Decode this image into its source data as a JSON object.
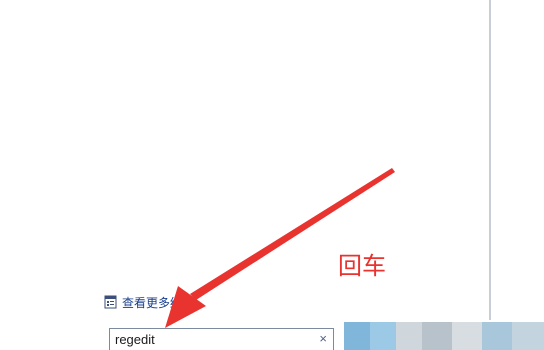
{
  "start_menu": {
    "see_more_label": "查看更多结果",
    "search": {
      "value": "regedit",
      "clear_glyph": "×"
    }
  },
  "annotation": {
    "text": "回车",
    "color": "#e8332f"
  },
  "icons": {
    "see_more": "search-results-icon",
    "clear": "close-icon"
  },
  "colors": {
    "link_text": "#1a3f8c",
    "arrow": "#e8332f",
    "taskbar_tiles": [
      "#7fb6d9",
      "#9cc9e6",
      "#cfd6dc",
      "#b8c2cb",
      "#d8dde2",
      "#a9c7db",
      "#c4d4df"
    ]
  }
}
